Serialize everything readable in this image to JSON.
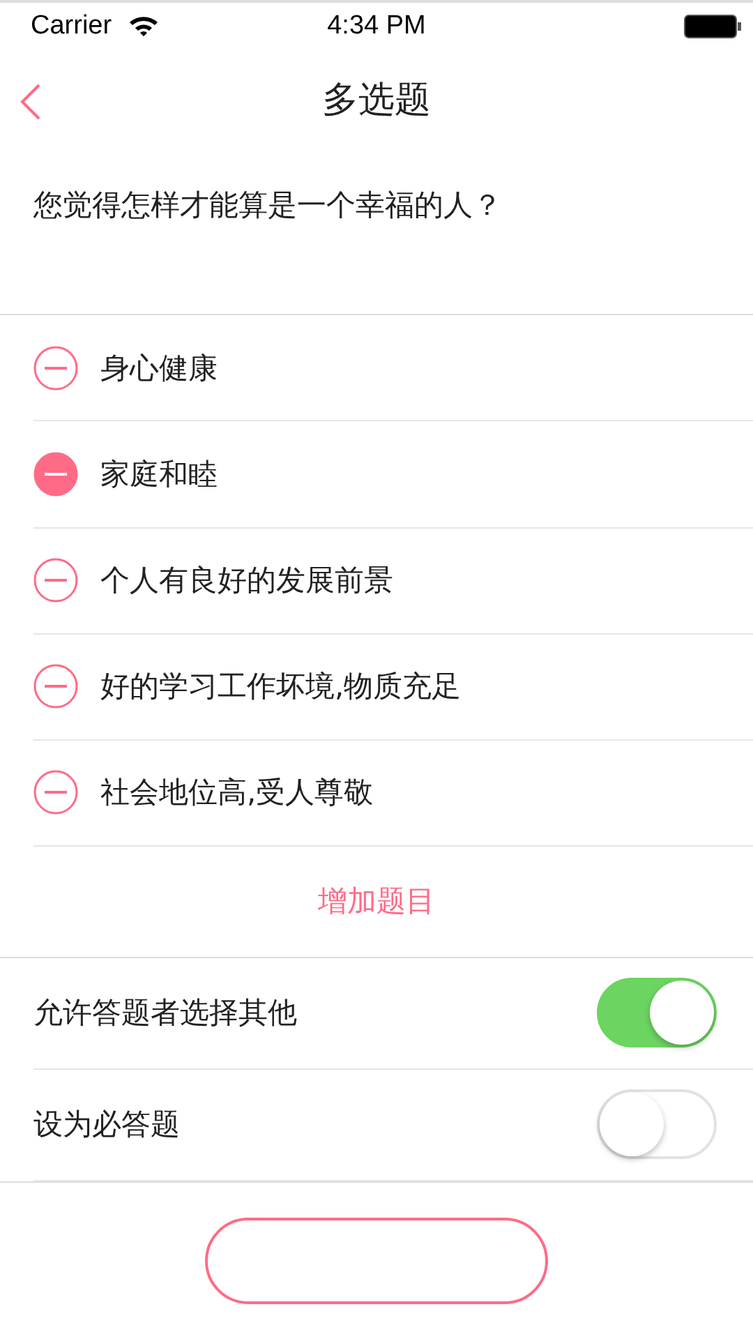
{
  "status_bar": {
    "carrier": "Carrier",
    "time": "4:34 PM"
  },
  "nav": {
    "title": "多选题"
  },
  "question": "您觉得怎样才能算是一个幸福的人？",
  "options": [
    {
      "label": "身心健康",
      "selected": false
    },
    {
      "label": "家庭和睦",
      "selected": true
    },
    {
      "label": "个人有良好的发展前景",
      "selected": false
    },
    {
      "label": "好的学习工作坏境,物质充足",
      "selected": false
    },
    {
      "label": "社会地位高,受人尊敬",
      "selected": false
    }
  ],
  "add_button": "增加题目",
  "settings": [
    {
      "label": "允许答题者选择其他",
      "on": true
    },
    {
      "label": "设为必答题",
      "on": false
    }
  ]
}
